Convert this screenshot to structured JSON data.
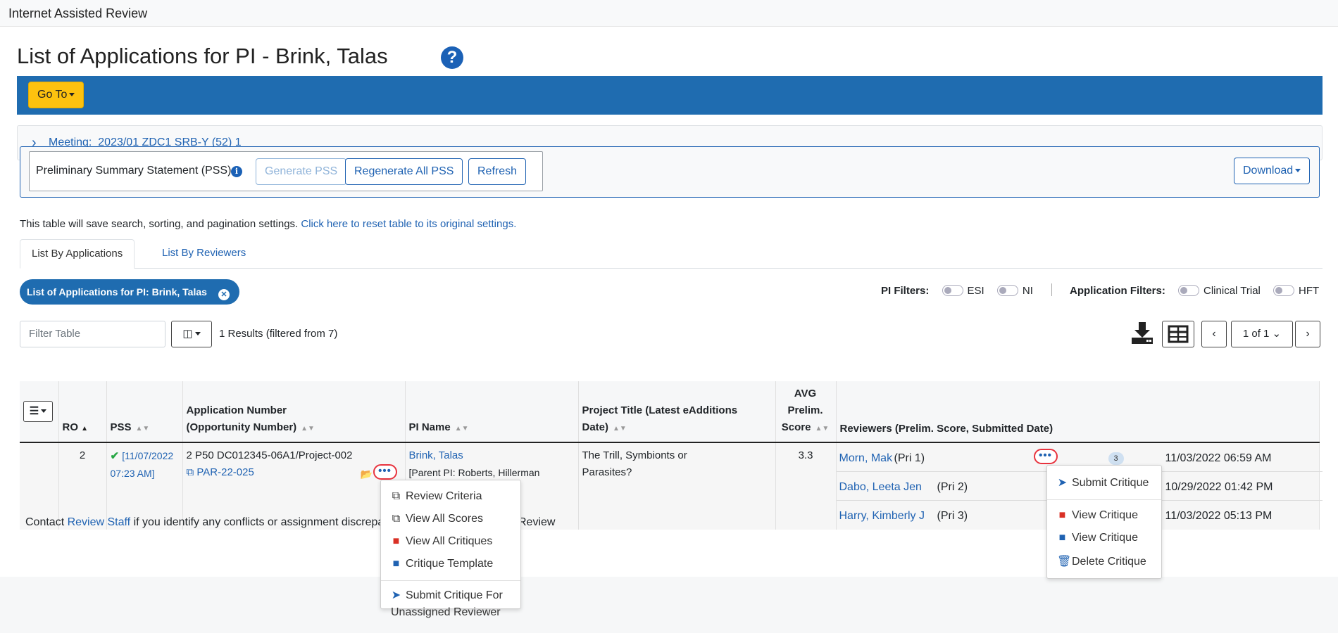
{
  "app_title": "Internet Assisted Review",
  "page_title": "List of Applications for PI - Brink, Talas",
  "goto_label": "Go To",
  "meeting": {
    "label": "Meeting:",
    "value": "2023/01 ZDC1 SRB-Y (52) 1"
  },
  "pss": {
    "label": "Preliminary Summary Statement (PSS)",
    "buttons": [
      "Generate PSS",
      "Regenerate All PSS",
      "Refresh"
    ],
    "download": "Download"
  },
  "table_note": {
    "text": "This table will save search, sorting, and pagination settings.",
    "link": "Click here to reset table to its original settings."
  },
  "tabs": [
    "List By Applications",
    "List By Reviewers"
  ],
  "chip": "List of Applications for PI: Brink, Talas",
  "pi_filters": {
    "label": "PI Filters:",
    "items": [
      "ESI",
      "NI"
    ]
  },
  "app_filters": {
    "label": "Application Filters:",
    "items": [
      "Clinical Trial",
      "HFT"
    ]
  },
  "filter_placeholder": "Filter Table",
  "results_text": "1 Results (filtered from 7)",
  "pagination": {
    "current": "1 of 1"
  },
  "columns": {
    "ro": "RO",
    "pss": "PSS",
    "app_num_1": "Application Number",
    "app_num_2": "(Opportunity Number)",
    "pi_name": "PI Name",
    "title_1": "Project Title (Latest eAdditions",
    "title_2": "Date)",
    "avg_1": "AVG",
    "avg_2": "Prelim.",
    "avg_3": "Score",
    "reviewers": "Reviewers (Prelim. Score, Submitted Date)"
  },
  "row": {
    "ro": "2",
    "pss_date_1": "[11/07/2022",
    "pss_date_2": "07:23 AM]",
    "app_number": "2 P50 DC012345-06A1/Project-002",
    "opp_number": "PAR-22-025",
    "pi_name": "Brink, Talas",
    "parent_pi": "[Parent PI: Roberts, Hillerman",
    "title_1": "The Trill, Symbionts or",
    "title_2": "Parasites?",
    "avg_score": "3.3",
    "reviewers": [
      {
        "name": "Morn, Mak",
        "role": "(Pri 1)",
        "badge": "3",
        "date": "11/03/2022 06:59 AM"
      },
      {
        "name": "Dabo, Leeta Jen",
        "role": "(Pri 2)",
        "date": "10/29/2022 01:42 PM"
      },
      {
        "name": "Harry, Kimberly J",
        "role": "(Pri 3)",
        "date": "11/03/2022 05:13 PM"
      }
    ]
  },
  "app_menu": [
    "Review Criteria",
    "View All Scores",
    "View All Critiques",
    "Critique Template",
    "Submit Critique For",
    "Unassigned Reviewer"
  ],
  "reviewer_menu": [
    "Submit Critique",
    "View Critique",
    "View Critique",
    "Delete Critique"
  ],
  "footer": {
    "prefix": "Contact",
    "link": "Review Staff",
    "text": "if you identify any conflicts or assignment discrepa",
    "suffix": "Review"
  }
}
